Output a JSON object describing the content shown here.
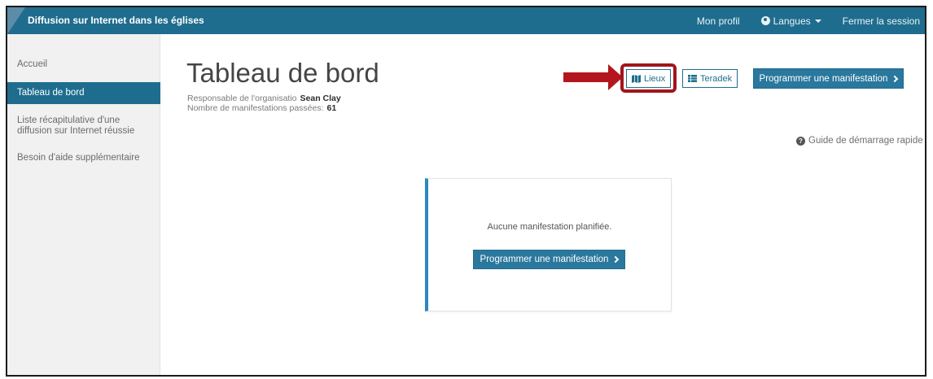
{
  "header": {
    "brand": "Diffusion sur Internet dans les églises",
    "profile": "Mon profil",
    "languages": "Langues",
    "logout": "Fermer la session"
  },
  "sidebar": {
    "items": [
      {
        "label": "Accueil"
      },
      {
        "label": "Tableau de bord"
      },
      {
        "label": "Liste récapitulative d'une diffusion sur Internet réussie"
      },
      {
        "label": "Besoin d'aide supplémentaire"
      }
    ]
  },
  "main": {
    "title": "Tableau de bord",
    "owner_label": "Responsable de l'organisatio",
    "owner_name": "Sean Clay",
    "past_label": "Nombre de manifestations passées:",
    "past_count": "61",
    "buttons": {
      "lieux": "Lieux",
      "teradek": "Teradek",
      "schedule": "Programmer une manifestation"
    },
    "guide": "Guide de démarrage rapide",
    "empty_card": {
      "message": "Aucune manifestation planifiée.",
      "button": "Programmer une manifestation"
    }
  },
  "colors": {
    "primary": "#1f6d8e",
    "card_accent": "#2d88c0",
    "highlight": "#a3141b"
  }
}
